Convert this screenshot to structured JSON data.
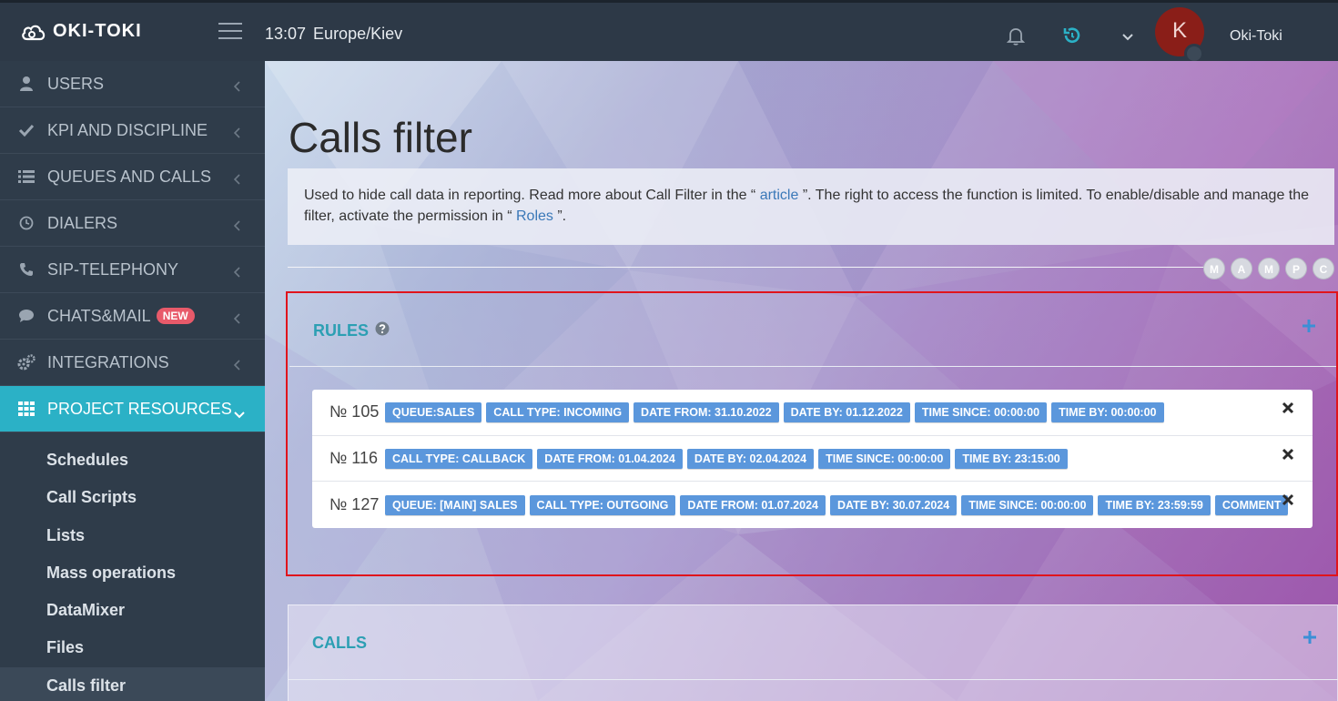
{
  "topbar": {
    "logo": "OKI-TOKI",
    "time": "13:07",
    "timezone": "Europe/Kiev",
    "avatar_letter": "K",
    "user_name": "Oki-Toki"
  },
  "sidebar": {
    "items": [
      {
        "label": "USERS",
        "icon": "user-icon"
      },
      {
        "label": "KPI AND DISCIPLINE",
        "icon": "check-icon"
      },
      {
        "label": "QUEUES AND CALLS",
        "icon": "list-icon"
      },
      {
        "label": "DIALERS",
        "icon": "clock-icon"
      },
      {
        "label": "SIP-TELEPHONY",
        "icon": "phone-icon"
      },
      {
        "label": "CHATS&MAIL",
        "icon": "chat-icon",
        "badge": "NEW"
      },
      {
        "label": "INTEGRATIONS",
        "icon": "gears-icon"
      },
      {
        "label": "PROJECT RESOURCES",
        "icon": "grid-icon"
      }
    ],
    "sub_items": [
      "Schedules",
      "Call Scripts",
      "Lists",
      "Mass operations",
      "DataMixer",
      "Files",
      "Calls filter"
    ]
  },
  "main": {
    "title": "Calls filter",
    "info": {
      "part1": "Used to hide call data in reporting. Read more about Call Filter in the “ ",
      "link1": "article",
      "part2": " ”. The right to access the function is limited. To enable/disable and manage the filter, activate the permission in “ ",
      "link2": "Roles",
      "part3": " ”."
    },
    "initials": [
      "M",
      "A",
      "M",
      "P",
      "C"
    ],
    "rules_title": "RULES",
    "calls_title": "CALLS",
    "rules": [
      {
        "num": "№ 105",
        "tags": [
          "QUEUE:SALES",
          "CALL TYPE: INCOMING",
          "DATE FROM: 31.10.2022",
          "DATE BY: 01.12.2022",
          "TIME SINCE: 00:00:00",
          "TIME BY: 00:00:00"
        ]
      },
      {
        "num": "№ 116",
        "tags": [
          "CALL TYPE: CALLBACK",
          "DATE FROM: 01.04.2024",
          "DATE BY: 02.04.2024",
          "TIME SINCE: 00:00:00",
          "TIME BY: 23:15:00"
        ]
      },
      {
        "num": "№ 127",
        "tags": [
          "QUEUE: [MAIN] SALES",
          "CALL TYPE: OUTGOING",
          "DATE FROM: 01.07.2024",
          "DATE BY: 30.07.2024",
          "TIME SINCE: 00:00:00",
          "TIME BY: 23:59:59",
          "COMMENT"
        ]
      }
    ]
  },
  "colors": {
    "accent": "#2bb1c6",
    "tag": "#5b97dc",
    "highlight_border": "#e0141c",
    "badge_new": "#e85a6a"
  }
}
